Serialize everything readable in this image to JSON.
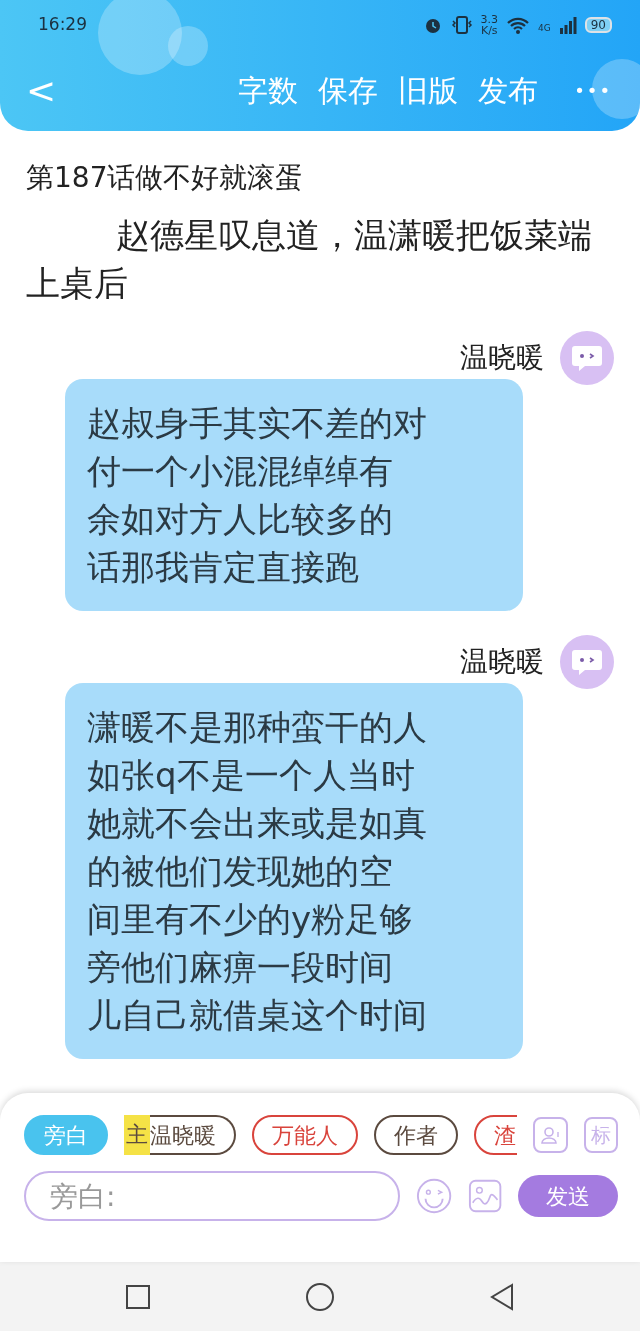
{
  "status_bar": {
    "time": "16:29",
    "speed": "3.3",
    "speed_unit": "K/s",
    "network": "4G",
    "battery": "90"
  },
  "header": {
    "back": "<",
    "actions": [
      "字数",
      "保存",
      "旧版",
      "发布"
    ],
    "more": "•••"
  },
  "chapter_title": "第187话做不好就滚蛋",
  "narration": "赵德星叹息道，温潇暖把饭菜端上桌后",
  "messages": [
    {
      "speaker": "温晓暖",
      "lines": [
        "赵叔身手其实不差的对",
        "付一个小混混绰绰有",
        "余如对方人比较多的",
        "话那我肯定直接跑"
      ]
    },
    {
      "speaker": "温晓暖",
      "lines": [
        "潇暖不是那种蛮干的人",
        "如张q不是一个人当时",
        "她就不会出来或是如真",
        "的被他们发现她的空",
        "间里有不少的y粉足够",
        "旁他们麻痹一段时间",
        "儿自己就借桌这个时间"
      ]
    }
  ],
  "composer": {
    "roles": [
      {
        "kind": "narration",
        "label": "旁白",
        "selected": true
      },
      {
        "kind": "character",
        "label": "温晓暖",
        "main_mark": "主",
        "selected": false,
        "color": "#5b4a3f"
      },
      {
        "kind": "character",
        "label": "万能人",
        "selected": false,
        "color": "#d9443c"
      },
      {
        "kind": "character",
        "label": "作者",
        "selected": false,
        "color": "#5b4a3f"
      },
      {
        "kind": "character",
        "label": "渣",
        "selected": false,
        "color": "#d9443c"
      }
    ],
    "tag_button": "标",
    "input": {
      "placeholder": "旁白:"
    },
    "send": "发送"
  }
}
